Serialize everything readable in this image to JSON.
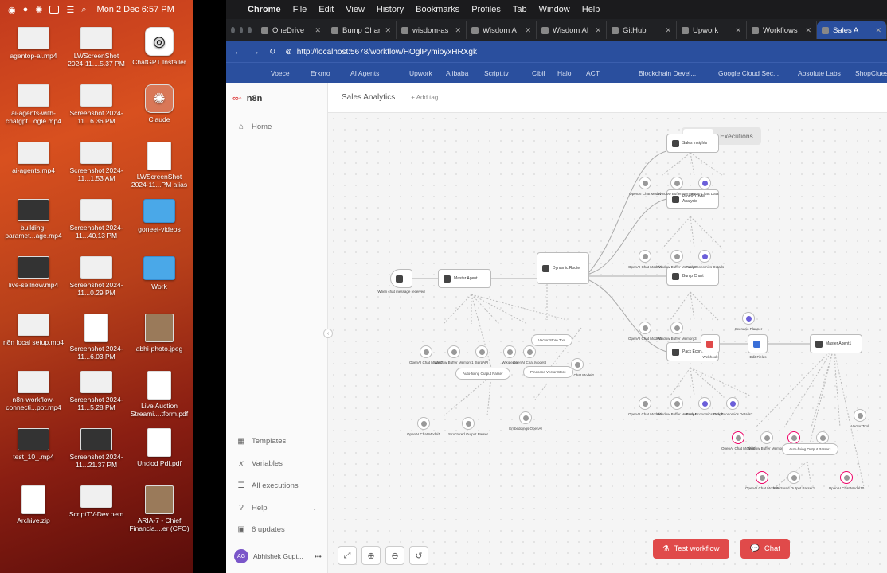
{
  "desktop": {
    "clock": "Mon 2 Dec  6:57 PM",
    "icons": [
      {
        "label": "agentop-ai.mp4",
        "kind": "thumb"
      },
      {
        "label": "LWScreenShot 2024-11....5.37 PM",
        "kind": "thumb"
      },
      {
        "label": "ChatGPT Installer",
        "kind": "app"
      },
      {
        "label": "ai-agents-with-chatgpt...ogle.mp4",
        "kind": "thumb"
      },
      {
        "label": "Screenshot 2024-11...6.36 PM",
        "kind": "thumb"
      },
      {
        "label": "Claude",
        "kind": "claude"
      },
      {
        "label": "ai-agents.mp4",
        "kind": "thumb"
      },
      {
        "label": "Screenshot 2024-11...1.53 AM",
        "kind": "thumb"
      },
      {
        "label": "LWScreenShot 2024-11...PM alias",
        "kind": "doc"
      },
      {
        "label": "building-paramet...age.mp4",
        "kind": "dark"
      },
      {
        "label": "Screenshot 2024-11...40.13 PM",
        "kind": "thumb"
      },
      {
        "label": "goneet-videos",
        "kind": "folder"
      },
      {
        "label": "live-sellnow.mp4",
        "kind": "dark"
      },
      {
        "label": "Screenshot 2024-11...0.29 PM",
        "kind": "thumb"
      },
      {
        "label": "Work",
        "kind": "folder"
      },
      {
        "label": "n8n local setup.mp4",
        "kind": "thumb"
      },
      {
        "label": "Screenshot 2024-11...6.03 PM",
        "kind": "doc"
      },
      {
        "label": "abhi-photo.jpeg",
        "kind": "photo"
      },
      {
        "label": "n8n-workflow-connecti...pot.mp4",
        "kind": "thumb"
      },
      {
        "label": "Screenshot 2024-11...5.28 PM",
        "kind": "thumb"
      },
      {
        "label": "Live Auction Streami....tform.pdf",
        "kind": "doc"
      },
      {
        "label": "test_10_.mp4",
        "kind": "dark"
      },
      {
        "label": "Screenshot 2024-11...21.37 PM",
        "kind": "dark"
      },
      {
        "label": "Unclod Pdf.pdf",
        "kind": "doc"
      },
      {
        "label": "Archive.zip",
        "kind": "doc"
      },
      {
        "label": "ScriptTV-Dev.pem",
        "kind": "thumb"
      },
      {
        "label": "ARIA-7 - Chief Financia....er (CFO)",
        "kind": "photo"
      }
    ]
  },
  "app_menu": [
    "Chrome",
    "File",
    "Edit",
    "View",
    "History",
    "Bookmarks",
    "Profiles",
    "Tab",
    "Window",
    "Help"
  ],
  "tabs": [
    "OneDrive",
    "Bump Char",
    "wisdom-as",
    "Wisdom A",
    "Wisdom AI",
    "GitHub",
    "Upwork",
    "Workflows",
    "Sales A"
  ],
  "address": {
    "url": "http://localhost:5678/workflow/HOglPymioyxHRXgk"
  },
  "bookmarks": [
    "Voece",
    "Erkmo",
    "AI Agents",
    "Upwork",
    "Alibaba",
    "Script.tv",
    "Cibil",
    "Halo",
    "ACT",
    "Blockchain Devel...",
    "Google Cloud Sec...",
    "Absolute Labs",
    "ShopClues"
  ],
  "sidebar": {
    "brand": "n8n",
    "home": "Home",
    "templates": "Templates",
    "variables": "Variables",
    "executions": "All executions",
    "help": "Help",
    "updates": "6 updates",
    "user_initials": "AG",
    "user_name": "Abhishek Gupt..."
  },
  "workflow": {
    "name": "Sales Analytics",
    "add_tag": "+ Add tag"
  },
  "toggle": {
    "editor": "Editor",
    "executions": "Executions"
  },
  "nodes": [
    {
      "id": "chat-trigger",
      "label": "When chat message received"
    },
    {
      "id": "master-agent",
      "label": "Master Agent"
    },
    {
      "id": "dynamic-router",
      "label": "Dynamic Router"
    },
    {
      "id": "sales-insights",
      "label": "Sales Insights"
    },
    {
      "id": "promo-code",
      "label": "Promo Code Analysis"
    },
    {
      "id": "bump-chart",
      "label": "Bump Chart"
    },
    {
      "id": "pack-economics",
      "label": "Pack Economics"
    },
    {
      "id": "webhook",
      "label": "Webhook"
    },
    {
      "id": "edit-fields",
      "label": "Edit Fields"
    },
    {
      "id": "master-agent-1",
      "label": "Master Agent1"
    }
  ],
  "subnodes": [
    "OpenAI Chat Model",
    "Window Buffer Memory",
    "Bump Chart Data",
    "OpenAI Chat Model4",
    "Window Buffer Memory2",
    "Pack Economics Details",
    "OpenAI Chat Model5",
    "Window Buffer Memory3",
    "OpenAI Chat Model6",
    "Window Buffer Memory4",
    "Pack Economics Graph",
    "Pack Economics Details2",
    "OpenAI Chat Model7",
    "Window Buffer Memory1",
    "SerpAPI",
    "Wikipedia",
    "OpenAI Chat Model3",
    "Vector Store Tool",
    "OpenAI Chat Model2",
    "Auto-fixing Output Parser",
    "Pinecone Vector Store",
    "Embeddings OpenAI",
    "OpenAI Chat Model1",
    "Structured Output Parser",
    "Scenario Planner",
    "OpenAI Chat Model8",
    "Window Buffer Memory5",
    "SerpAPI1",
    "Wikipedia1",
    "Auto-fixing Output Parser1",
    "OpenAI Chat Model9",
    "Structured Output Parser1",
    "OpenAI Chat Model10",
    "Vector Tool"
  ],
  "actions": {
    "test": "Test workflow",
    "chat": "Chat"
  }
}
